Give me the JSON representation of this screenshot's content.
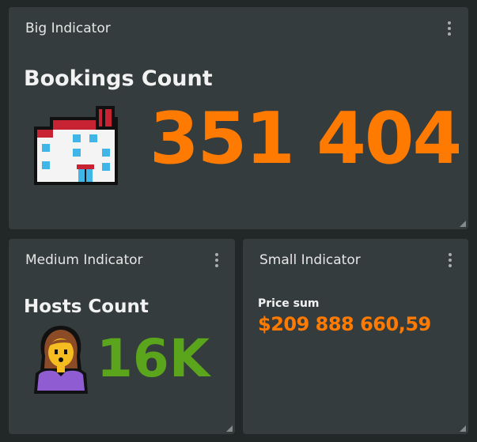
{
  "colors": {
    "background": "#222828",
    "panel": "#353c3d",
    "orange": "#ff7a00",
    "green": "#5ba51c"
  },
  "big_panel": {
    "title": "Big Indicator",
    "menu_icon": "kebab-menu-icon",
    "label": "Bookings Count",
    "icon": "hotel-icon",
    "value": "351 404"
  },
  "medium_panel": {
    "title": "Medium Indicator",
    "menu_icon": "kebab-menu-icon",
    "label": "Hosts Count",
    "icon": "woman-icon",
    "value": "16K"
  },
  "small_panel": {
    "title": "Small Indicator",
    "menu_icon": "kebab-menu-icon",
    "label": "Price sum",
    "value": "$209 888 660,59"
  }
}
